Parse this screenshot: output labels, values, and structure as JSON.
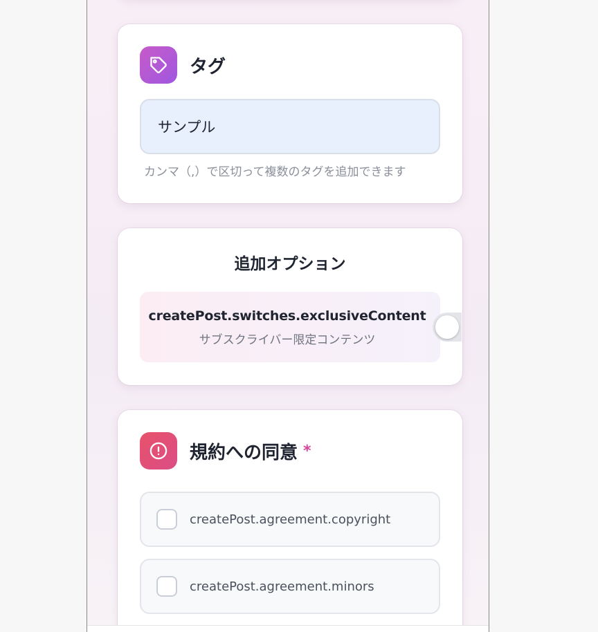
{
  "tags": {
    "icon": "tag-icon",
    "title": "タグ",
    "input_value": "サンプル",
    "hint": "カンマ（,）で区切って複数のタグを追加できます"
  },
  "options": {
    "title": "追加オプション",
    "exclusive": {
      "label": "createPost.switches.exclusiveContent",
      "description": "サブスクライバー限定コンテンツ",
      "enabled": false
    }
  },
  "agreement": {
    "icon": "alert-circle-icon",
    "title": "規約への同意",
    "required_mark": "*",
    "items": [
      {
        "label": "createPost.agreement.copyright",
        "checked": false
      },
      {
        "label": "createPost.agreement.minors",
        "checked": false
      }
    ]
  },
  "colors": {
    "accent_purple": "#b459d6",
    "accent_red": "#e24f73",
    "required": "#d6459b",
    "input_bg": "#e8effd"
  }
}
